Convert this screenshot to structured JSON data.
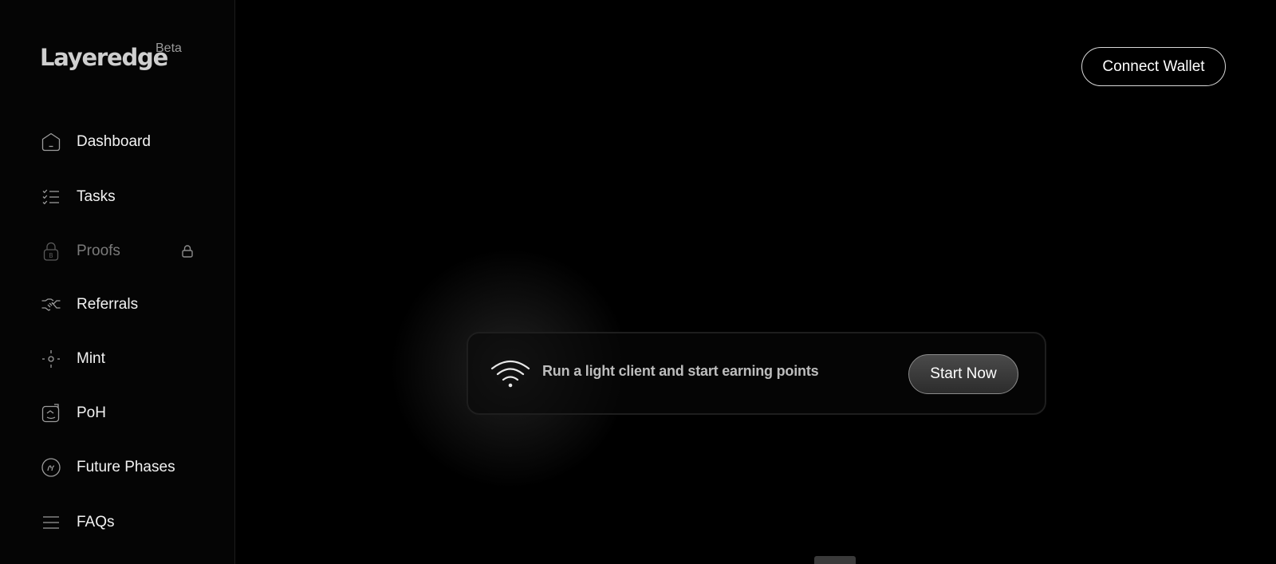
{
  "brand": {
    "logo_text": "Layeredge",
    "badge": "Beta"
  },
  "sidebar": {
    "items": [
      {
        "label": "Dashboard",
        "icon": "home-pentagon-icon",
        "locked": false
      },
      {
        "label": "Tasks",
        "icon": "checklist-icon",
        "locked": false
      },
      {
        "label": "Proofs",
        "icon": "lock-bitcoin-icon",
        "locked": true
      },
      {
        "label": "Referrals",
        "icon": "handshake-icon",
        "locked": false
      },
      {
        "label": "Mint",
        "icon": "crosshair-icon",
        "locked": false
      },
      {
        "label": "PoH",
        "icon": "face-scan-icon",
        "locked": false
      },
      {
        "label": "Future Phases",
        "icon": "rising-coin-icon",
        "locked": false
      },
      {
        "label": "FAQs",
        "icon": "menu-lines-icon",
        "locked": false
      }
    ]
  },
  "header": {
    "connect_label": "Connect Wallet"
  },
  "banner": {
    "icon": "wifi-icon",
    "text": "Run a light client and start earning points",
    "cta_label": "Start Now"
  },
  "colors": {
    "background": "#000000",
    "sidebar": "#050505",
    "text": "#ffffff",
    "muted": "#7a7a7a"
  }
}
